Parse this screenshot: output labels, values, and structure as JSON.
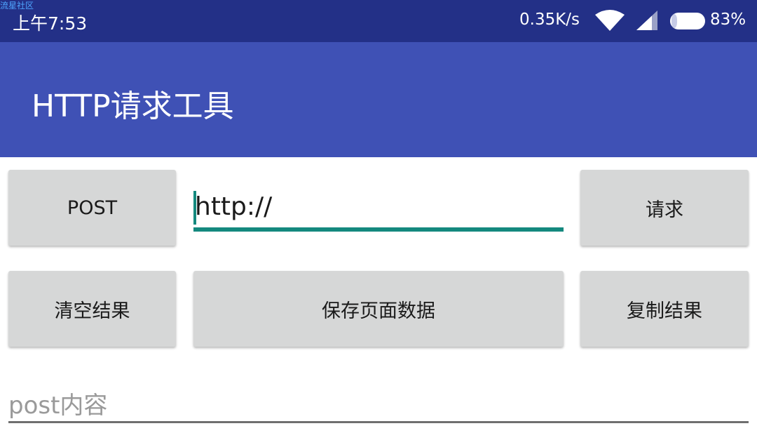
{
  "status_bar": {
    "watermark": "流星社区",
    "time": "上午7:53",
    "net_speed": "0.35K/s",
    "battery_percent": "83%",
    "icons": [
      "wifi-icon",
      "cellular-signal-icon",
      "battery-icon"
    ],
    "background_color": "#233087"
  },
  "app_bar": {
    "title": "HTTP请求工具",
    "background_color": "#3f51b5"
  },
  "controls": {
    "method_button": "POST",
    "url_input_value": "http://",
    "request_button": "请求",
    "clear_button": "清空结果",
    "save_button": "保存页面数据",
    "copy_button": "复制结果",
    "accent_color": "#14897e"
  },
  "post_body": {
    "placeholder": "post内容"
  }
}
